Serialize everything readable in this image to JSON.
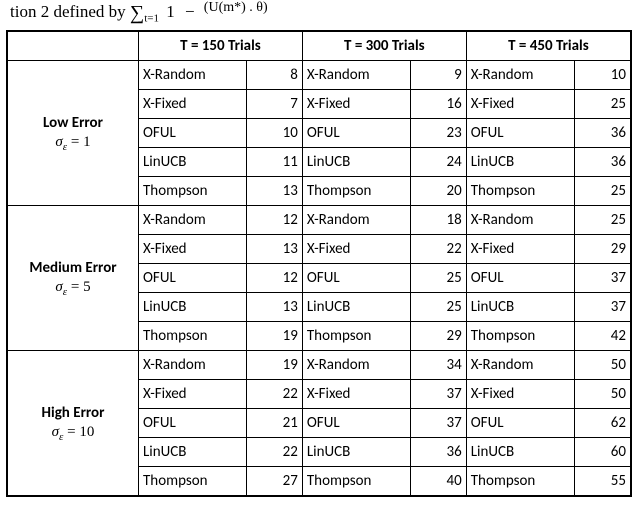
{
  "caption": {
    "prefix": "tion 2 defined by ",
    "sum_symbol": "∑",
    "sum_sub": "t=1",
    "one": "1",
    "minus": "−",
    "frac_num": "",
    "frac_den": "(U(m*) . θ)"
  },
  "headers": [
    "T = 150 Trials",
    "T = 300 Trials",
    "T = 450 Trials"
  ],
  "algorithms": [
    "X-Random",
    "X-Fixed",
    "OFUL",
    "LinUCB",
    "Thompson"
  ],
  "groups": [
    {
      "label": "Low Error",
      "sigma_value": "1",
      "data": [
        [
          8,
          9,
          10
        ],
        [
          7,
          16,
          25
        ],
        [
          10,
          23,
          36
        ],
        [
          11,
          24,
          36
        ],
        [
          13,
          20,
          25
        ]
      ]
    },
    {
      "label": "Medium Error",
      "sigma_value": "5",
      "data": [
        [
          12,
          18,
          25
        ],
        [
          13,
          22,
          29
        ],
        [
          12,
          25,
          37
        ],
        [
          13,
          25,
          37
        ],
        [
          19,
          29,
          42
        ]
      ]
    },
    {
      "label": "High Error",
      "sigma_value": "10",
      "data": [
        [
          19,
          34,
          50
        ],
        [
          22,
          37,
          50
        ],
        [
          21,
          37,
          62
        ],
        [
          22,
          36,
          60
        ],
        [
          27,
          40,
          55
        ]
      ]
    }
  ],
  "sigma_label_html": "σ<sub>ε</sub> ="
}
